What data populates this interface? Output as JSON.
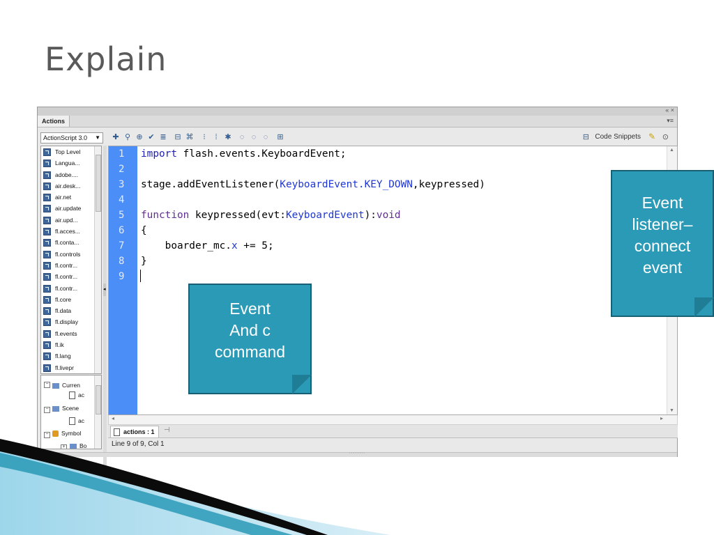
{
  "slide": {
    "title": "Explain"
  },
  "panel": {
    "tab_label": "Actions",
    "window_controls": "« ×",
    "panel_menu": "▾≡",
    "language_select": "ActionScript 3.0",
    "code_snippets_label": "Code Snippets",
    "library_items": [
      "Top Level",
      "Langua...",
      "adobe....",
      "air.desk...",
      "air.net",
      "air.update",
      "air.upd...",
      "fl.acces...",
      "fl.conta...",
      "fl.controls",
      "fl.contr...",
      "fl.contr...",
      "fl.contr...",
      "fl.core",
      "fl.data",
      "fl.display",
      "fl.events",
      "fl.ik",
      "fl.lang",
      "fl.livepr"
    ],
    "tree": {
      "current": "Curren",
      "current_child": "ac",
      "scene": "Scene",
      "scene_child": "ac",
      "symbol": "Symbol",
      "symbol_child": "Bo"
    },
    "line_numbers": [
      "1",
      "2",
      "3",
      "4",
      "5",
      "6",
      "7",
      "8",
      "9"
    ],
    "code": {
      "l1": {
        "kw": "import",
        "rest": " flash.events.KeyboardEvent;"
      },
      "l3": {
        "a": "stage.addEventListener(",
        "cls": "KeyboardEvent",
        "b": ".KEY_DOWN",
        "c": ",keypressed)"
      },
      "l5": {
        "kw": "function",
        "a": " keypressed(evt:",
        "cls": "KeyboardEvent",
        "b": "):",
        "void": "void"
      },
      "l6": "{",
      "l7": {
        "a": "    boarder_mc.",
        "x": "x",
        "b": " += 5;"
      },
      "l8": "}"
    },
    "bottom_tab": "actions : 1",
    "status": "Line 9 of 9, Col 1"
  },
  "callouts": {
    "event_command": [
      "Event",
      "And c",
      "command"
    ],
    "listener": [
      "Event",
      "listener–",
      "connect",
      "event"
    ]
  },
  "colors": {
    "callout_fill": "#2a9ab7",
    "gutter": "#4b8ef8",
    "keyword": "#2020b8"
  }
}
